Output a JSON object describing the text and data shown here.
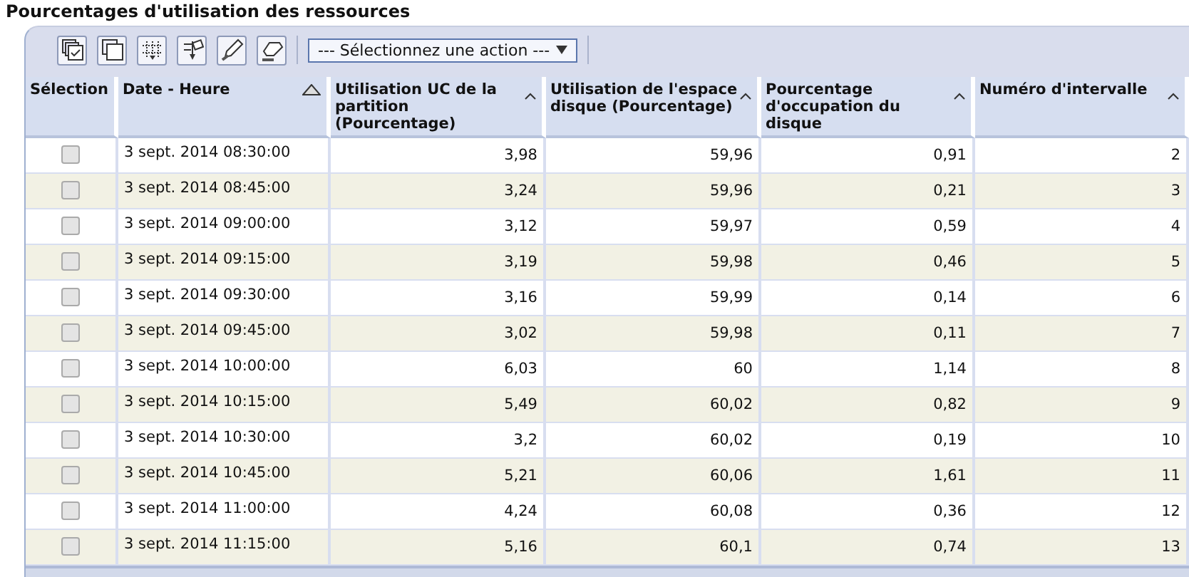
{
  "title": "Pourcentages d'utilisation des ressources",
  "toolbar": {
    "action_select": {
      "value": "--- Sélectionnez une action ---"
    }
  },
  "table": {
    "columns": [
      {
        "label": "Sélection",
        "sortable": false
      },
      {
        "label": "Date - Heure",
        "sortable": true,
        "sorted": true
      },
      {
        "label": "Utilisation UC de la partition (Pourcentage)",
        "sortable": true,
        "sorted": false
      },
      {
        "label": "Utilisation de l'espace disque (Pourcentage)",
        "sortable": true,
        "sorted": false
      },
      {
        "label": "Pourcentage d'occupation du disque",
        "sortable": true,
        "sorted": false
      },
      {
        "label": "Numéro d'intervalle",
        "sortable": true,
        "sorted": false
      }
    ],
    "rows": [
      {
        "checked": false,
        "cells": [
          "",
          "3 sept. 2014 08:30:00",
          "3,98",
          "59,96",
          "0,91",
          "2"
        ]
      },
      {
        "checked": false,
        "cells": [
          "",
          "3 sept. 2014 08:45:00",
          "3,24",
          "59,96",
          "0,21",
          "3"
        ]
      },
      {
        "checked": false,
        "cells": [
          "",
          "3 sept. 2014 09:00:00",
          "3,12",
          "59,97",
          "0,59",
          "4"
        ]
      },
      {
        "checked": false,
        "cells": [
          "",
          "3 sept. 2014 09:15:00",
          "3,19",
          "59,98",
          "0,46",
          "5"
        ]
      },
      {
        "checked": false,
        "cells": [
          "",
          "3 sept. 2014 09:30:00",
          "3,16",
          "59,99",
          "0,14",
          "6"
        ]
      },
      {
        "checked": false,
        "cells": [
          "",
          "3 sept. 2014 09:45:00",
          "3,02",
          "59,98",
          "0,11",
          "7"
        ]
      },
      {
        "checked": false,
        "cells": [
          "",
          "3 sept. 2014 10:00:00",
          "6,03",
          "60",
          "1,14",
          "8"
        ]
      },
      {
        "checked": false,
        "cells": [
          "",
          "3 sept. 2014 10:15:00",
          "5,49",
          "60,02",
          "0,82",
          "9"
        ]
      },
      {
        "checked": false,
        "cells": [
          "",
          "3 sept. 2014 10:30:00",
          "3,2",
          "60,02",
          "0,19",
          "10"
        ]
      },
      {
        "checked": false,
        "cells": [
          "",
          "3 sept. 2014 10:45:00",
          "5,21",
          "60,06",
          "1,61",
          "11"
        ]
      },
      {
        "checked": false,
        "cells": [
          "",
          "3 sept. 2014 11:00:00",
          "4,24",
          "60,08",
          "0,36",
          "12"
        ]
      },
      {
        "checked": false,
        "cells": [
          "",
          "3 sept. 2014 11:15:00",
          "5,16",
          "60,1",
          "0,74",
          "13"
        ]
      }
    ]
  }
}
